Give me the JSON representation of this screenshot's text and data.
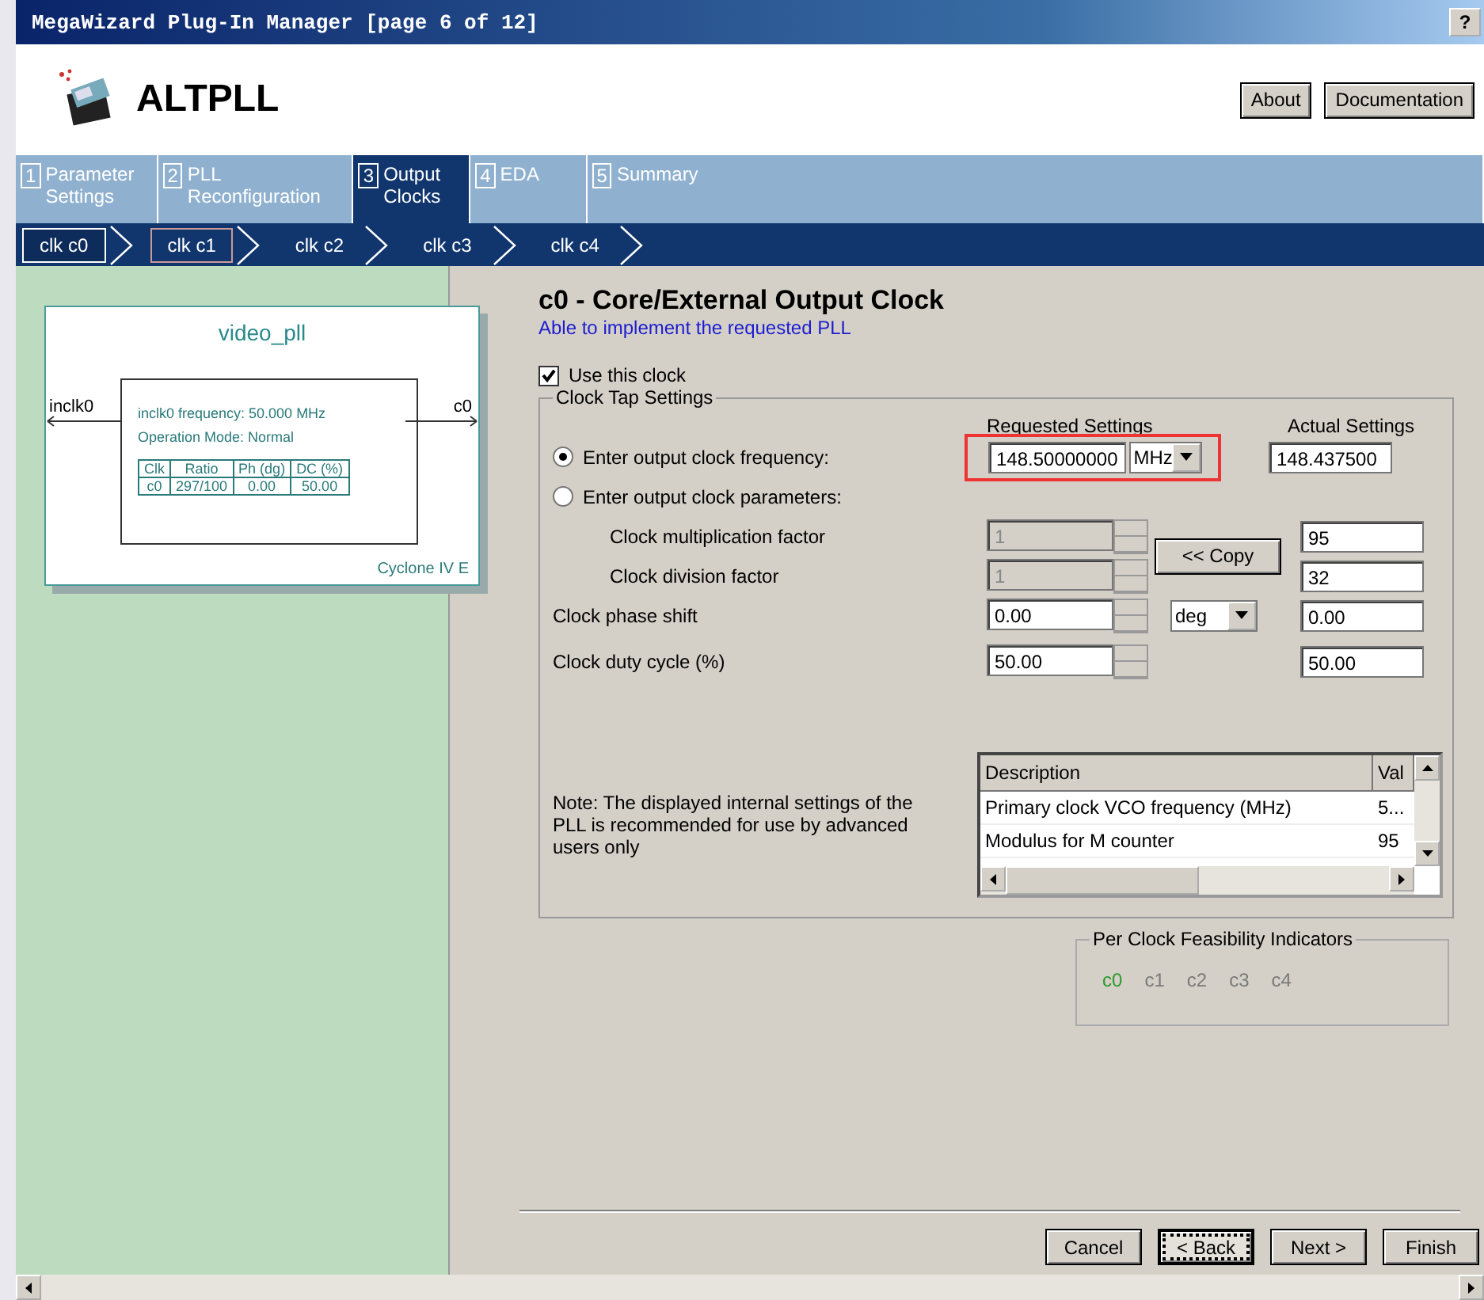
{
  "window": {
    "title": "MegaWizard Plug-In Manager [page 6 of 12]",
    "help_button": "?"
  },
  "header": {
    "product": "ALTPLL",
    "buttons": [
      "About",
      "Documentation"
    ]
  },
  "tabs": [
    {
      "number": "1",
      "label": "Parameter Settings",
      "selected": false
    },
    {
      "number": "2",
      "label": "PLL Reconfiguration",
      "selected": false
    },
    {
      "number": "3",
      "label": "Output Clocks",
      "selected": true
    },
    {
      "number": "4",
      "label": "EDA",
      "selected": false
    },
    {
      "number": "5",
      "label": "Summary",
      "selected": false
    }
  ],
  "clock_tabs": [
    {
      "label": "clk c0",
      "selected": true,
      "focused": false
    },
    {
      "label": "clk c1",
      "selected": false,
      "focused": true
    },
    {
      "label": "clk c2",
      "selected": false,
      "focused": false
    },
    {
      "label": "clk c3",
      "selected": false,
      "focused": false
    },
    {
      "label": "clk c4",
      "selected": false,
      "focused": false
    }
  ],
  "diagram": {
    "name": "video_pll",
    "input": "inclk0",
    "output": "c0",
    "info": [
      "inclk0 frequency: 50.000 MHz",
      "Operation Mode: Normal"
    ],
    "table": {
      "columns": [
        "Clk",
        "Ratio",
        "Ph (dg)",
        "DC (%)"
      ],
      "rows": [
        [
          "c0",
          "297/100",
          "0.00",
          "50.00"
        ]
      ]
    },
    "device": "Cyclone IV E"
  },
  "panel": {
    "title": "c0 - Core/External Output Clock",
    "status": "Able to implement the requested PLL",
    "use_clock": {
      "label": "Use this clock",
      "checked": true
    },
    "group": {
      "title": "Clock Tap Settings",
      "requested_heading": "Requested Settings",
      "actual_heading": "Actual Settings",
      "copy_button": "<< Copy",
      "rows": [
        {
          "kind": "radio",
          "label": "Enter output clock frequency:",
          "selected": true,
          "value": "148.50000000",
          "unit": "MHz",
          "actual": "148.437500",
          "highlighted": true
        },
        {
          "kind": "radio",
          "label": "Enter output clock parameters:",
          "selected": false
        },
        {
          "kind": "param",
          "label": "Clock multiplication factor",
          "value": "1",
          "disabled": true,
          "actual": "95"
        },
        {
          "kind": "param",
          "label": "Clock division factor",
          "value": "1",
          "disabled": true,
          "actual": "32"
        },
        {
          "kind": "spin",
          "label": "Clock phase shift",
          "value": "0.00",
          "unit": "deg",
          "actual": "0.00"
        },
        {
          "kind": "spin",
          "label": "Clock duty cycle (%)",
          "value": "50.00",
          "actual": "50.00"
        }
      ],
      "note": "Note: The displayed internal settings of the PLL is recommended for use by advanced users only",
      "table": {
        "columns": [
          "Description",
          "Val"
        ],
        "rows": [
          [
            "Primary clock VCO frequency (MHz)",
            "5..."
          ],
          [
            "Modulus for M counter",
            "95"
          ]
        ]
      }
    },
    "feasibility": {
      "title": "Per Clock Feasibility Indicators",
      "clocks": [
        {
          "label": "c0",
          "feasible": true
        },
        {
          "label": "c1",
          "feasible": false
        },
        {
          "label": "c2",
          "feasible": false
        },
        {
          "label": "c3",
          "feasible": false
        },
        {
          "label": "c4",
          "feasible": false
        }
      ]
    }
  },
  "buttons": [
    {
      "label": "Cancel",
      "focused": false
    },
    {
      "label": "< Back",
      "focused": true
    },
    {
      "label": "Next >",
      "focused": false
    },
    {
      "label": "Finish",
      "focused": false
    }
  ]
}
